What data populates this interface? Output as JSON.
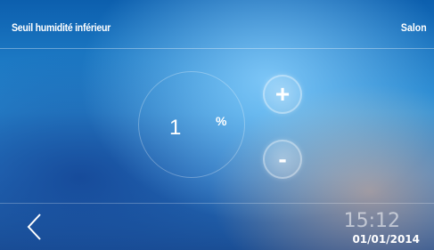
{
  "header": {
    "title": "Seuil humidité inférieur",
    "room": "Salon"
  },
  "setpoint": {
    "value": "1",
    "unit": "%"
  },
  "controls": {
    "increase_label": "+",
    "decrease_label": "-"
  },
  "footer": {
    "back_icon": "chevron-left-icon",
    "time": "15:12",
    "date": "01/01/2014"
  }
}
